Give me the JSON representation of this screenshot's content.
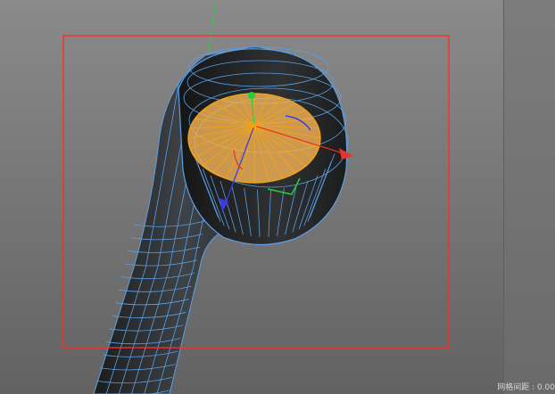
{
  "viewport": {
    "status": {
      "grid_spacing": "网格间距 : 0.00"
    }
  },
  "colors": {
    "wire": "#5aa0e6",
    "selected_polygon_fill": "#f0b257",
    "selected_edges": "#f2a21a",
    "render_safe_frame": "#ff2a2a",
    "axis_x": "#e8332b",
    "axis_y": "#1fd23a",
    "axis_z": "#3a3ae0"
  },
  "icons": {
    "move_gizmo": "move-gizmo-icon"
  }
}
